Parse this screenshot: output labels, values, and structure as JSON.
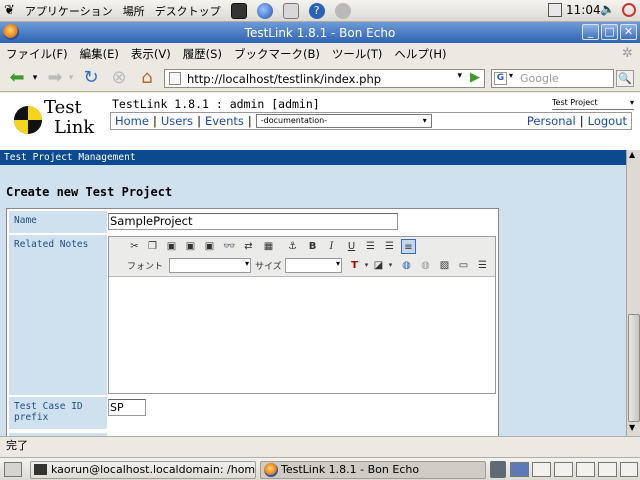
{
  "top_panel": {
    "applications": "アプリケーション",
    "places": "場所",
    "desktop": "デスクトップ",
    "clock": "11:04"
  },
  "window": {
    "title": "TestLink 1.8.1 - Bon Echo",
    "min": "_",
    "max": "□",
    "close": "✕"
  },
  "menubar": {
    "items": [
      "ファイル(F)",
      "編集(E)",
      "表示(V)",
      "履歴(S)",
      "ブックマーク(B)",
      "ツール(T)",
      "ヘルプ(H)"
    ]
  },
  "navbar": {
    "url": "http://localhost/testlink/index.php",
    "search_placeholder": "Google"
  },
  "testlink": {
    "logo_line1": "Test",
    "logo_line2": "Link",
    "title": "TestLink 1.8.1 : admin [admin]",
    "project_label": "Test Project",
    "menu": [
      "Home",
      "Users",
      "Events"
    ],
    "doc_select": "-documentation-",
    "personal": "Personal",
    "logout": "Logout",
    "section": "Test Project Management",
    "heading": "Create new Test Project"
  },
  "form": {
    "name_label": "Name",
    "name_value": "SampleProject",
    "notes_label": "Related Notes",
    "font_label": "フォント",
    "size_label": "サイズ",
    "prefix_label": "Test Case ID prefix",
    "prefix_value": "SP"
  },
  "statusbar": {
    "text": "完了"
  },
  "bottom_panel": {
    "task1": "kaorun@localhost.localdomain: /home·",
    "task2": "TestLink 1.8.1 - Bon Echo"
  },
  "colors": {
    "section_bar": "#0b4a8f",
    "label_bg": "#cfe0ef",
    "link": "#1a4aa8"
  }
}
